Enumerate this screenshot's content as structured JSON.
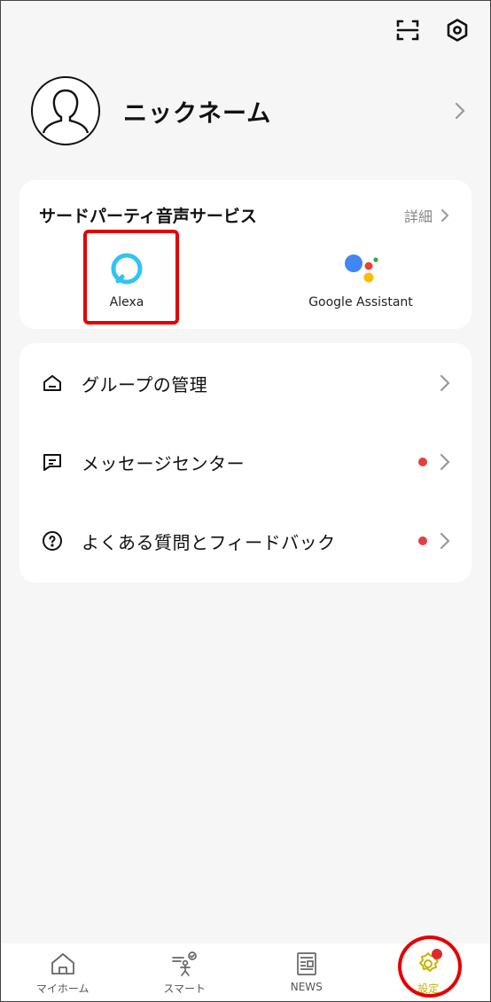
{
  "header": {
    "scan_icon": "scan-icon",
    "settings_icon": "hexagon-settings-icon"
  },
  "profile": {
    "nickname": "ニックネーム"
  },
  "voice_services": {
    "title": "サードパーティ音声サービス",
    "detail_label": "詳細",
    "items": [
      {
        "label": "Alexa",
        "icon": "alexa-icon"
      },
      {
        "label": "Google Assistant",
        "icon": "google-assistant-icon"
      }
    ]
  },
  "menu": {
    "items": [
      {
        "label": "グループの管理",
        "icon": "home-icon",
        "badge": false
      },
      {
        "label": "メッセージセンター",
        "icon": "message-icon",
        "badge": true
      },
      {
        "label": "よくある質問とフィードバック",
        "icon": "question-icon",
        "badge": true
      }
    ]
  },
  "tabbar": {
    "tabs": [
      {
        "label": "マイホーム",
        "icon": "home-icon"
      },
      {
        "label": "スマート",
        "icon": "smart-icon"
      },
      {
        "label": "NEWS",
        "icon": "news-icon"
      },
      {
        "label": "設定",
        "icon": "settings-icon",
        "active": true,
        "badge": true
      }
    ]
  },
  "colors": {
    "accent_active": "#c9b200",
    "badge_red": "#e04040",
    "highlight_red": "#e50000",
    "alexa_blue": "#31c4f3"
  }
}
